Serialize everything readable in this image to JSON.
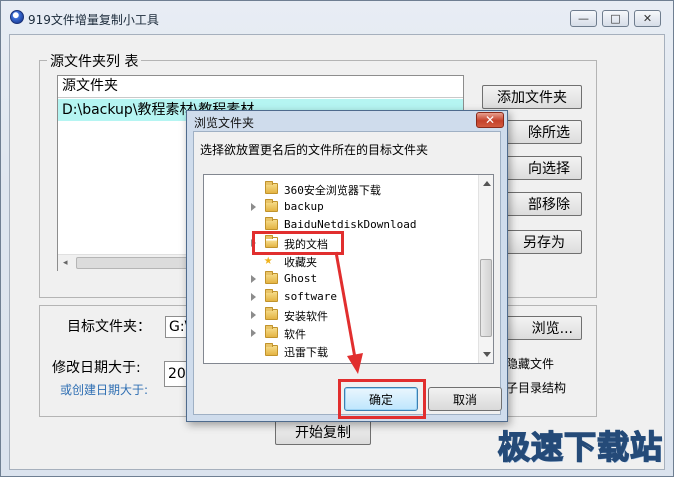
{
  "window": {
    "title": "919文件增量复制小工具",
    "min_label": "—",
    "max_label": "□",
    "close_label": "✕"
  },
  "source_group": {
    "legend": "源文件夹列 表",
    "list_header": "源文件夹",
    "selected_item": "D:\\backup\\教程素材\\教程素材"
  },
  "side_buttons": {
    "add": "添加文件夹",
    "remove": "除所选",
    "invert": "向选择",
    "remove_all": "部移除",
    "save_as": "另存为"
  },
  "target": {
    "label": "目标文件夹：",
    "value": "G:\\",
    "browse": "浏览..."
  },
  "date": {
    "label": "修改日期大于:",
    "sub_label": "或创建日期大于:",
    "value": "20"
  },
  "options": {
    "hidden_files": "隐藏文件",
    "dir_structure": "子目录结构"
  },
  "start_button": "开始复制",
  "dialog": {
    "title": "浏览文件夹",
    "close_label": "✕",
    "prompt": "选择欲放置更名后的文件所在的目标文件夹",
    "tree": [
      {
        "label": "360安全浏览器下载",
        "expandable": false,
        "icon": "folder-icon"
      },
      {
        "label": "backup",
        "expandable": true,
        "icon": "folder-icon"
      },
      {
        "label": "BaiduNetdiskDownload",
        "expandable": false,
        "icon": "folder-icon"
      },
      {
        "label": "我的文档",
        "expandable": true,
        "icon": "documents-folder-icon",
        "highlighted": true
      },
      {
        "label": "收藏夹",
        "expandable": false,
        "icon": "star-icon"
      },
      {
        "label": "Ghost",
        "expandable": true,
        "icon": "folder-icon"
      },
      {
        "label": "software",
        "expandable": true,
        "icon": "folder-icon"
      },
      {
        "label": "安装软件",
        "expandable": true,
        "icon": "folder-icon"
      },
      {
        "label": "软件",
        "expandable": true,
        "icon": "folder-icon"
      },
      {
        "label": "迅雷下载",
        "expandable": false,
        "icon": "folder-icon"
      }
    ],
    "ok": "确定",
    "cancel": "取消"
  },
  "watermark": "极速下载站",
  "colors": {
    "highlight_red": "#e12e2e",
    "list_selection": "#b5f5f2",
    "title_bar": "#dbe3ee"
  }
}
